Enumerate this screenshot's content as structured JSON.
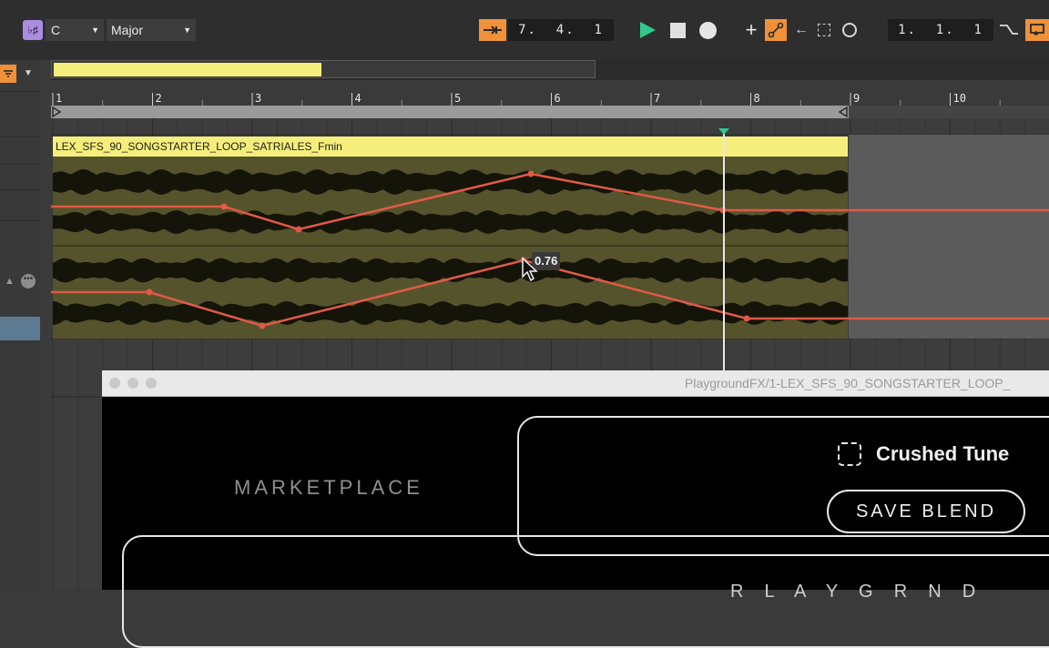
{
  "toolbar": {
    "key_value": "C",
    "scale_value": "Major",
    "position": "7.  4.  1",
    "loop_start": "1.  1.  1"
  },
  "ruler": {
    "bars": [
      "1",
      "2",
      "3",
      "4",
      "5",
      "6",
      "7",
      "8",
      "9",
      "10"
    ]
  },
  "clip": {
    "name": "LEX_SFS_90_SONGSTARTER_LOOP_SATRIALES_Fmin",
    "automation_value": "0.76"
  },
  "plugin": {
    "title": "PlaygroundFX/1-LEX_SFS_90_SONGSTARTER_LOOP_",
    "marketplace_label": "MARKETPLACE",
    "preset_name": "Crushed Tune",
    "save_button": "SAVE BLEND",
    "bottom_letters": "R  L  A  Y  G  R  N  D"
  },
  "colors": {
    "accent_orange": "#f0913a",
    "clip_yellow": "#f5ee7c",
    "automation_red": "#e05a47",
    "play_green": "#2fc98e"
  }
}
